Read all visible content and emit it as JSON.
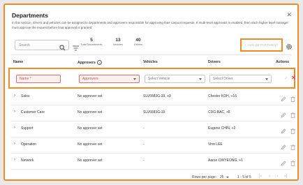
{
  "dialog": {
    "title": "Departments",
    "description": "In this section, drivers and vehicles can be assigned to departments and approvers responsible for approving their carpool requests. If multi-level approvals is enabled, then each higher level manager must approve the request before final approval is granted."
  },
  "toolbar": {
    "search_placeholder": "Search",
    "stats": [
      {
        "value": "5",
        "label": "Total Departments"
      },
      {
        "value": "13",
        "label": "Vehicles"
      },
      {
        "value": "40",
        "label": "Drivers"
      }
    ],
    "add_label": "+ ADD DEPARTMENT"
  },
  "table": {
    "columns": {
      "name": "Name",
      "approvers": "Approvers",
      "vehicles": "Vehicles",
      "drivers": "Drivers",
      "actions": "Actions"
    },
    "new_row": {
      "name_placeholder": "Name *",
      "approvers_placeholder": "Approvers",
      "vehicle_placeholder": "Select Vehicle",
      "driver_placeholder": "Select Driver"
    },
    "rows": [
      {
        "name": "Sales",
        "approver": "No approver set",
        "vehicles": "SLV6683G-19, +9",
        "drivers": "Chester KOH, +16"
      },
      {
        "name": "Customer Care",
        "approver": "No approver set",
        "vehicles": "SLV6683G-19",
        "drivers": "CDG-BAC, +8"
      },
      {
        "name": "Support",
        "approver": "No approver set",
        "vehicles": "-",
        "drivers": "Eugene CHIN, +2"
      },
      {
        "name": "Operation",
        "approver": "No approver set",
        "vehicles": "-",
        "drivers": "Vino LEE"
      },
      {
        "name": "Network",
        "approver": "No approver set",
        "vehicles": "-",
        "drivers": "Aaron OWYEONG, +1"
      }
    ]
  },
  "pagination": {
    "rows_per_page_label": "Rows per page:",
    "rows_per_page": "25",
    "range": "1 - 5 of 5"
  },
  "colors": {
    "accent": "#f08a24",
    "error": "#e04848"
  },
  "icons": [
    "close-icon",
    "search-icon",
    "filter-icon",
    "settings-icon",
    "info-icon",
    "chevron-down-icon",
    "chevron-right-icon",
    "check-icon",
    "cancel-icon",
    "edit-icon",
    "delete-icon"
  ]
}
